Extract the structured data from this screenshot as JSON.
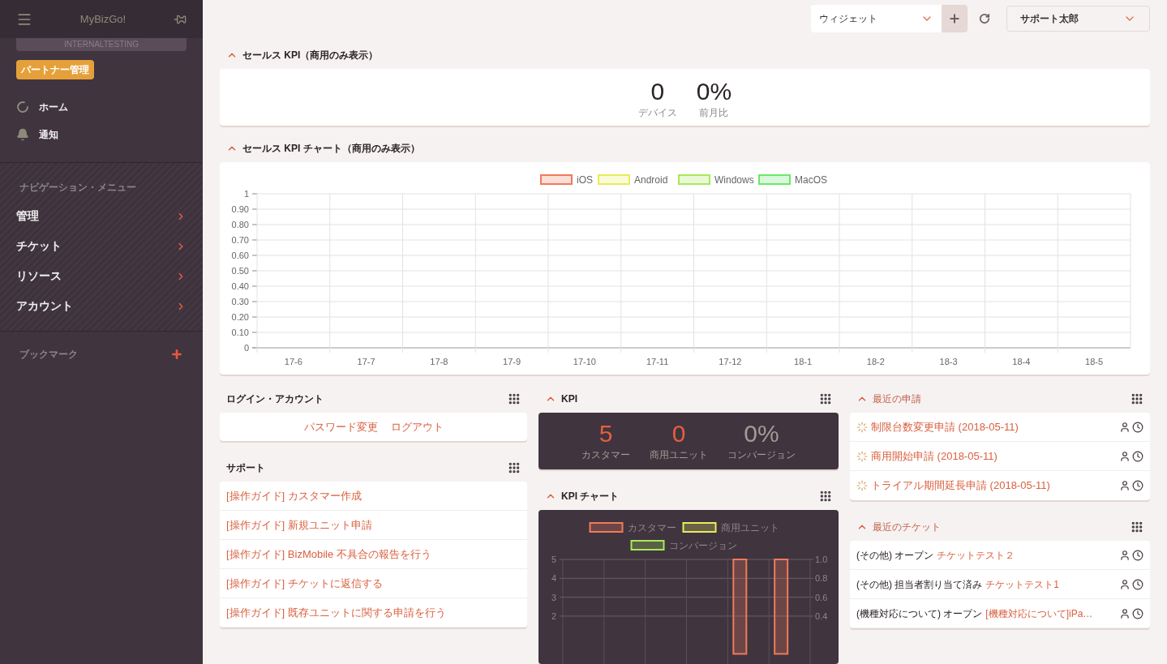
{
  "sidebar": {
    "title": "MyBizGo!",
    "environment": "INTERNALTESTING",
    "badge": "パートナー管理",
    "quick_items": [
      {
        "kind": "home",
        "label": "ホーム"
      },
      {
        "kind": "notice",
        "label": "通知"
      }
    ],
    "nav_heading": "ナビゲーション・メニュー",
    "nav_items": [
      {
        "label": "管理"
      },
      {
        "label": "チケット"
      },
      {
        "label": "リソース"
      },
      {
        "label": "アカウント"
      }
    ],
    "bookmark_heading": "ブックマーク"
  },
  "topbar": {
    "widget_select": {
      "value": "ウィジェット"
    },
    "user_menu": {
      "value": "サポート太郎"
    }
  },
  "sales_kpi": {
    "title": "セールス KPI（商用のみ表示）",
    "expanded": true,
    "stats": [
      {
        "value": "0",
        "label": "デバイス"
      },
      {
        "value": "0%",
        "label": "前月比"
      }
    ]
  },
  "sales_chart": {
    "title": "セールス KPI チャート（商用のみ表示）",
    "expanded": true,
    "chart_data": {
      "type": "line",
      "categories": [
        "17-6",
        "17-7",
        "17-8",
        "17-9",
        "17-10",
        "17-11",
        "17-12",
        "18-1",
        "18-2",
        "18-3",
        "18-4",
        "18-5"
      ],
      "series": [
        {
          "name": "iOS",
          "color": "#f07a5a",
          "values": [
            null,
            null,
            null,
            null,
            null,
            null,
            null,
            null,
            null,
            null,
            null,
            null
          ]
        },
        {
          "name": "Android",
          "color": "#e8ec5a",
          "values": [
            null,
            null,
            null,
            null,
            null,
            null,
            null,
            null,
            null,
            null,
            null,
            null
          ]
        },
        {
          "name": "Windows",
          "color": "#a8e85a",
          "values": [
            null,
            null,
            null,
            null,
            null,
            null,
            null,
            null,
            null,
            null,
            null,
            null
          ]
        },
        {
          "name": "MacOS",
          "color": "#6ae86a",
          "values": [
            null,
            null,
            null,
            null,
            null,
            null,
            null,
            null,
            null,
            null,
            null,
            null
          ]
        }
      ],
      "ylim": [
        0,
        1
      ],
      "grid": true,
      "legend": "top",
      "yticks": [
        {
          "value": 0,
          "label": "0"
        },
        {
          "value": 0.1,
          "label": "0.10"
        },
        {
          "value": 0.2,
          "label": "0.20"
        },
        {
          "value": 0.3,
          "label": "0.30"
        },
        {
          "value": 0.4,
          "label": "0.40"
        },
        {
          "value": 0.5,
          "label": "0.50"
        },
        {
          "value": 0.6,
          "label": "0.60"
        },
        {
          "value": 0.7,
          "label": "0.70"
        },
        {
          "value": 0.8,
          "label": "0.80"
        },
        {
          "value": 0.9,
          "label": "0.90"
        },
        {
          "value": 1,
          "label": "1"
        }
      ]
    }
  },
  "login_panel": {
    "title": "ログイン・アカウント",
    "links": [
      "パスワード変更",
      "ログアウト"
    ]
  },
  "support_panel": {
    "title": "サポート",
    "links": [
      "[操作ガイド] カスタマー作成",
      "[操作ガイド] 新規ユニット申請",
      "[操作ガイド] BizMobile 不具合の報告を行う",
      "[操作ガイド] チケットに返信する",
      "[操作ガイド] 既存ユニットに関する申請を行う"
    ]
  },
  "kpi_panel": {
    "title": "KPI",
    "expanded": true,
    "stats": [
      {
        "kind": "count",
        "value": "5",
        "label": "カスタマー"
      },
      {
        "kind": "count",
        "value": "0",
        "label": "商用ユニット"
      },
      {
        "kind": "percent",
        "value": "0%",
        "label": "コンバージョン"
      }
    ]
  },
  "kpi_chart": {
    "title": "KPI チャート",
    "expanded": true,
    "right_axis_ticks": [
      "1.0",
      "0.8",
      "0.6",
      "0.4"
    ],
    "chart_data": {
      "type": "bar",
      "series": [
        {
          "name": "カスタマー",
          "color": "#f07a5a",
          "values": [
            0,
            0,
            0,
            0,
            5,
            5
          ]
        },
        {
          "name": "商用ユニット",
          "color": "#e8ec5a",
          "values": [
            0,
            0,
            0,
            0,
            0,
            0
          ]
        },
        {
          "name": "コンバージョン",
          "color": "#a8e85a",
          "values": [
            0,
            0,
            0,
            0,
            0,
            0
          ]
        }
      ],
      "ylim": [
        0,
        5
      ],
      "yticks": [
        2,
        3,
        4,
        5
      ],
      "grid": true,
      "legend": "top"
    }
  },
  "requests_panel": {
    "title": "最近の申請",
    "expanded": true,
    "items": [
      {
        "text": "制限台数変更申請 (2018-05-11)"
      },
      {
        "text": "商用開始申請 (2018-05-11)"
      },
      {
        "text": "トライアル期間延長申請 (2018-05-11)"
      }
    ]
  },
  "tickets_panel": {
    "title": "最近のチケット",
    "expanded": true,
    "items": [
      {
        "status": "(その他) オープン",
        "title": "チケットテスト２"
      },
      {
        "status": "(その他) 担当者割り当て済み",
        "title": "チケットテスト1"
      },
      {
        "status": "(機種対応について) オープン",
        "title": "[機種対応について]iPa…"
      }
    ]
  }
}
